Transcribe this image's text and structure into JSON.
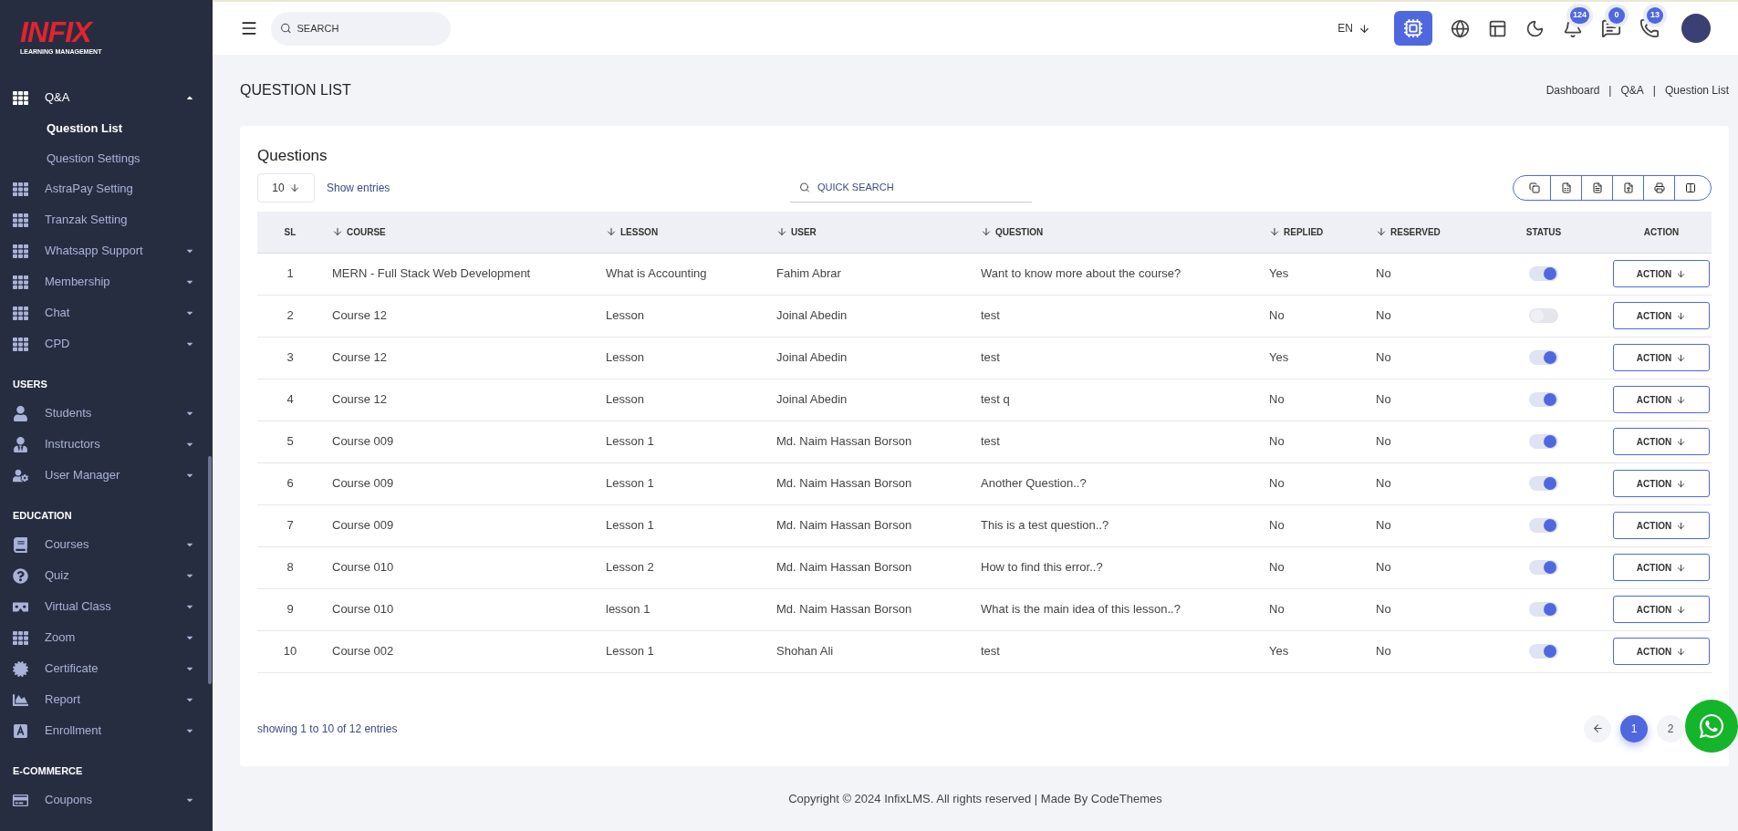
{
  "sidebar": {
    "logo": {
      "title": "INFIX",
      "subtitle": "LEARNING MANAGEMENT"
    },
    "sections": [
      {
        "items": [
          {
            "kind": "grid",
            "label": "Q&A",
            "has_submenu": true,
            "expanded": true,
            "children": [
              {
                "label": "Question List",
                "selected": true
              },
              {
                "label": "Question Settings",
                "selected": false
              }
            ]
          },
          {
            "kind": "grid",
            "label": "AstraPay Setting",
            "has_submenu": false,
            "expanded": false
          },
          {
            "kind": "grid",
            "label": "Tranzak Setting",
            "has_submenu": false,
            "expanded": false
          },
          {
            "kind": "grid",
            "label": "Whatsapp Support",
            "has_submenu": true,
            "expanded": false
          },
          {
            "kind": "grid",
            "label": "Membership",
            "has_submenu": true,
            "expanded": false
          },
          {
            "kind": "grid",
            "label": "Chat",
            "has_submenu": true,
            "expanded": false
          },
          {
            "kind": "grid",
            "label": "CPD",
            "has_submenu": true,
            "expanded": false
          }
        ]
      },
      {
        "heading": "USERS",
        "items": [
          {
            "kind": "user",
            "label": "Students",
            "has_submenu": true,
            "expanded": false
          },
          {
            "kind": "tie",
            "label": "Instructors",
            "has_submenu": true,
            "expanded": false
          },
          {
            "kind": "usergear",
            "label": "User Manager",
            "has_submenu": true,
            "expanded": false
          }
        ]
      },
      {
        "heading": "EDUCATION",
        "items": [
          {
            "kind": "book",
            "label": "Courses",
            "has_submenu": true,
            "expanded": false
          },
          {
            "kind": "question",
            "label": "Quiz",
            "has_submenu": true,
            "expanded": false
          },
          {
            "kind": "vr",
            "label": "Virtual Class",
            "has_submenu": true,
            "expanded": false
          },
          {
            "kind": "grid",
            "label": "Zoom",
            "has_submenu": true,
            "expanded": false
          },
          {
            "kind": "badge",
            "label": "Certificate",
            "has_submenu": true,
            "expanded": false
          },
          {
            "kind": "chart",
            "label": "Report",
            "has_submenu": true,
            "expanded": false
          },
          {
            "kind": "letter",
            "label": "Enrollment",
            "has_submenu": true,
            "expanded": false
          }
        ]
      },
      {
        "heading": "E-COMMERCE",
        "items": [
          {
            "kind": "card",
            "label": "Coupons",
            "has_submenu": true,
            "expanded": false
          }
        ]
      }
    ]
  },
  "topbar": {
    "search": {
      "placeholder": "SEARCH"
    },
    "language": "EN",
    "badges": [
      "124",
      "0",
      "13"
    ]
  },
  "page": {
    "title": "QUESTION LIST",
    "breadcrumb": [
      "Dashboard",
      "|",
      "Q&A",
      "|",
      "Question List"
    ]
  },
  "card": {
    "title": "Questions",
    "page_size": "10",
    "show_entries": "Show entries",
    "quick_search": {
      "placeholder": "QUICK SEARCH"
    },
    "columns": [
      {
        "label": "SL",
        "sortable": false
      },
      {
        "label": "COURSE",
        "sortable": true
      },
      {
        "label": "LESSON",
        "sortable": true
      },
      {
        "label": "USER",
        "sortable": true
      },
      {
        "label": "QUESTION",
        "sortable": true
      },
      {
        "label": "REPLIED",
        "sortable": true
      },
      {
        "label": "RESERVED",
        "sortable": true
      },
      {
        "label": "STATUS",
        "sortable": false
      },
      {
        "label": "ACTION",
        "sortable": false
      }
    ],
    "rows": [
      {
        "sl": "1",
        "course": "MERN - Full Stack Web Development",
        "lesson": "What is Accounting",
        "user": "Fahim Abrar",
        "question": "Want to know more about the course?",
        "replied": "Yes",
        "reserved": "No",
        "on": true,
        "action": "ACTION"
      },
      {
        "sl": "2",
        "course": "Course 12",
        "lesson": "Lesson",
        "user": "Joinal Abedin",
        "question": "test",
        "replied": "No",
        "reserved": "No",
        "on": false,
        "action": "ACTION"
      },
      {
        "sl": "3",
        "course": "Course 12",
        "lesson": "Lesson",
        "user": "Joinal Abedin",
        "question": "test",
        "replied": "Yes",
        "reserved": "No",
        "on": true,
        "action": "ACTION"
      },
      {
        "sl": "4",
        "course": "Course 12",
        "lesson": "Lesson",
        "user": "Joinal Abedin",
        "question": "test q",
        "replied": "No",
        "reserved": "No",
        "on": true,
        "action": "ACTION"
      },
      {
        "sl": "5",
        "course": "Course 009",
        "lesson": "Lesson 1",
        "user": "Md. Naim Hassan Borson",
        "question": "test",
        "replied": "No",
        "reserved": "No",
        "on": true,
        "action": "ACTION"
      },
      {
        "sl": "6",
        "course": "Course 009",
        "lesson": "Lesson 1",
        "user": "Md. Naim Hassan Borson",
        "question": "Another Question..?",
        "replied": "No",
        "reserved": "No",
        "on": true,
        "action": "ACTION"
      },
      {
        "sl": "7",
        "course": "Course 009",
        "lesson": "Lesson 1",
        "user": "Md. Naim Hassan Borson",
        "question": "This is a test question..?",
        "replied": "No",
        "reserved": "No",
        "on": true,
        "action": "ACTION"
      },
      {
        "sl": "8",
        "course": "Course 010",
        "lesson": "Lesson 2",
        "user": "Md. Naim Hassan Borson",
        "question": "How to find this error..?",
        "replied": "No",
        "reserved": "No",
        "on": true,
        "action": "ACTION"
      },
      {
        "sl": "9",
        "course": "Course 010",
        "lesson": "lesson 1",
        "user": "Md. Naim Hassan Borson",
        "question": "What is the main idea of this lesson..?",
        "replied": "No",
        "reserved": "No",
        "on": true,
        "action": "ACTION"
      },
      {
        "sl": "10",
        "course": "Course 002",
        "lesson": "Lesson 1",
        "user": "Shohan Ali",
        "question": "test",
        "replied": "Yes",
        "reserved": "No",
        "on": true,
        "action": "ACTION"
      }
    ],
    "summary": "showing 1 to 10 of 12 entries",
    "pages": [
      {
        "label": "1",
        "selected": true
      },
      {
        "label": "2",
        "selected": false
      }
    ]
  },
  "footer": "Copyright © 2024 InfixLMS. All rights reserved | Made By CodeThemes"
}
